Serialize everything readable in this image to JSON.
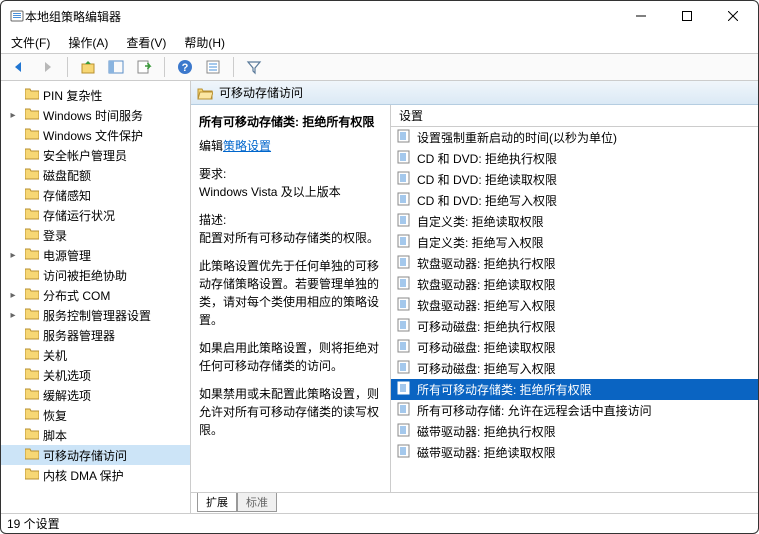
{
  "window": {
    "title": "本地组策略编辑器"
  },
  "menu": {
    "file": "文件(F)",
    "action": "操作(A)",
    "view": "查看(V)",
    "help": "帮助(H)"
  },
  "tree": {
    "items": [
      {
        "label": "PIN 复杂性",
        "expander": " "
      },
      {
        "label": "Windows 时间服务",
        "expander": "▸"
      },
      {
        "label": "Windows 文件保护",
        "expander": " "
      },
      {
        "label": "安全帐户管理员",
        "expander": " "
      },
      {
        "label": "磁盘配额",
        "expander": " "
      },
      {
        "label": "存储感知",
        "expander": " "
      },
      {
        "label": "存储运行状况",
        "expander": " "
      },
      {
        "label": "登录",
        "expander": " "
      },
      {
        "label": "电源管理",
        "expander": "▸"
      },
      {
        "label": "访问被拒绝协助",
        "expander": " "
      },
      {
        "label": "分布式 COM",
        "expander": "▸"
      },
      {
        "label": "服务控制管理器设置",
        "expander": "▸"
      },
      {
        "label": "服务器管理器",
        "expander": " "
      },
      {
        "label": "关机",
        "expander": " "
      },
      {
        "label": "关机选项",
        "expander": " "
      },
      {
        "label": "缓解选项",
        "expander": " "
      },
      {
        "label": "恢复",
        "expander": " "
      },
      {
        "label": "脚本",
        "expander": " "
      },
      {
        "label": "可移动存储访问",
        "expander": " ",
        "selected": true
      },
      {
        "label": "内核 DMA 保护",
        "expander": " "
      }
    ]
  },
  "rightHeader": {
    "title": "可移动存储访问"
  },
  "desc": {
    "heading": "所有可移动存储类: 拒绝所有权限",
    "editPrefix": "编辑",
    "editLink": "策略设置",
    "reqLabel": "要求:",
    "reqValue": "Windows Vista 及以上版本",
    "descLabel": "描述:",
    "descBody": "配置对所有可移动存储类的权限。",
    "p1": "此策略设置优先于任何单独的可移动存储策略设置。若要管理单独的类，请对每个类使用相应的策略设置。",
    "p2": "如果启用此策略设置，则将拒绝对任何可移动存储类的访问。",
    "p3": "如果禁用或未配置此策略设置，则允许对所有可移动存储类的读写权限。"
  },
  "list": {
    "header": "设置",
    "items": [
      "设置强制重新启动的时间(以秒为单位)",
      "CD 和 DVD: 拒绝执行权限",
      "CD 和 DVD: 拒绝读取权限",
      "CD 和 DVD: 拒绝写入权限",
      "自定义类: 拒绝读取权限",
      "自定义类: 拒绝写入权限",
      "软盘驱动器: 拒绝执行权限",
      "软盘驱动器: 拒绝读取权限",
      "软盘驱动器: 拒绝写入权限",
      "可移动磁盘: 拒绝执行权限",
      "可移动磁盘: 拒绝读取权限",
      "可移动磁盘: 拒绝写入权限",
      "所有可移动存储类: 拒绝所有权限",
      "所有可移动存储: 允许在远程会话中直接访问",
      "磁带驱动器: 拒绝执行权限",
      "磁带驱动器: 拒绝读取权限"
    ],
    "selectedIndex": 12
  },
  "tabs": {
    "extended": "扩展",
    "standard": "标准"
  },
  "status": "19 个设置"
}
